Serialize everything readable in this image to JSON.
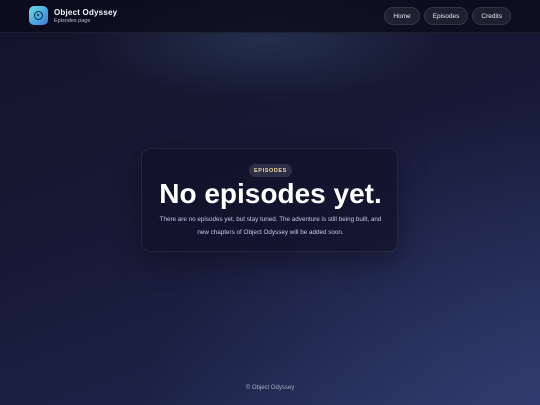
{
  "header": {
    "app_title": "Object Odyssey",
    "page_subtitle": "Episodes page",
    "logo_icon": "target-icon",
    "nav": [
      {
        "label": "Home"
      },
      {
        "label": "Episodes"
      },
      {
        "label": "Credits"
      }
    ]
  },
  "main": {
    "badge": "EPISODES",
    "heading": "No episodes yet.",
    "description": "There are no episodes yet, but stay tuned. The adventure is still being built, and new chapters of Object Odyssey will be added soon."
  },
  "footer": {
    "text": "© Object Odyssey"
  },
  "colors": {
    "background": "#171a36",
    "accent": "#4aa6e0",
    "badge_text": "#f3d9a8"
  }
}
